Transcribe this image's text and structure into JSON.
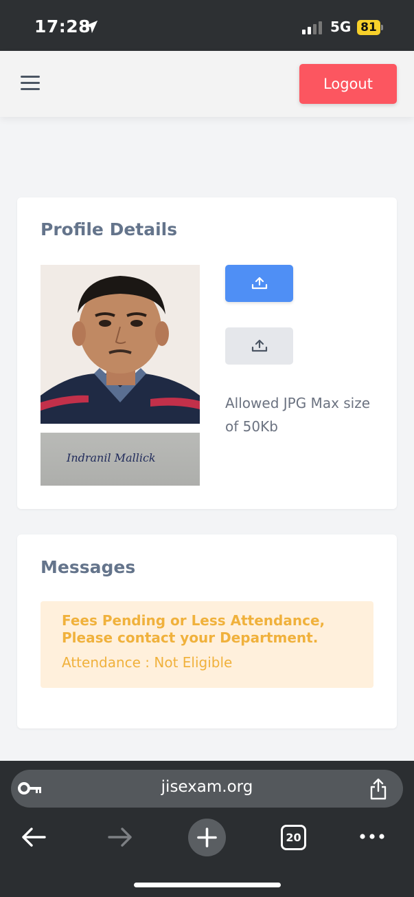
{
  "status_bar": {
    "time": "17:28",
    "network": "5G",
    "battery": "81"
  },
  "header": {
    "logout_label": "Logout"
  },
  "profile": {
    "title": "Profile Details",
    "upload_note": "Allowed JPG Max size of 50Kb",
    "signature_text": "Indranil Mallick"
  },
  "messages": {
    "title": "Messages",
    "alert_title": "Fees Pending or Less Attendance, Please contact your Department.",
    "alert_detail": "Attendance : Not Eligible"
  },
  "browser": {
    "url": "jisexam.org",
    "tab_count": "20"
  },
  "colors": {
    "logout": "#fc5660",
    "upload_primary": "#4f8ff5",
    "alert_bg": "#fff0dc",
    "alert_text": "#f0b13c"
  },
  "icons": [
    "location-arrow-icon",
    "signal-icon",
    "battery-icon",
    "menu-icon",
    "upload-icon",
    "key-icon",
    "share-icon",
    "back-arrow-icon",
    "forward-arrow-icon",
    "plus-icon",
    "more-icon"
  ]
}
